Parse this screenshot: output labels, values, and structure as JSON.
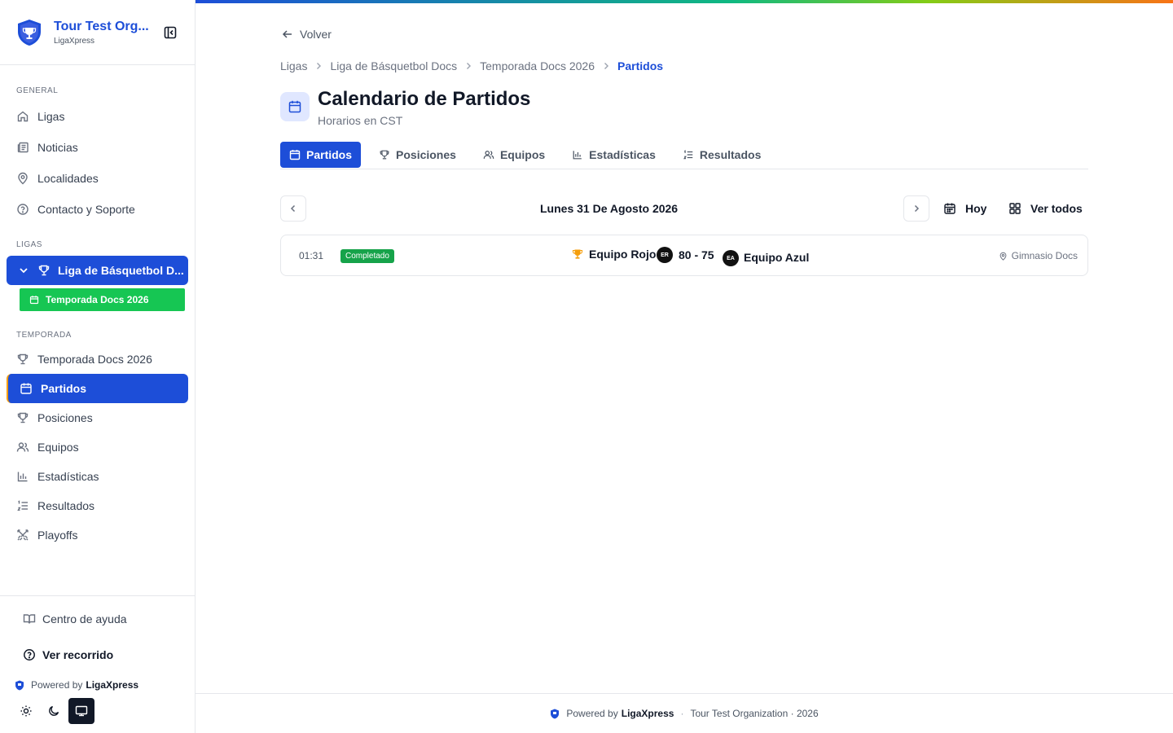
{
  "brand": {
    "name": "Tour Test Org...",
    "sub": "LigaXpress"
  },
  "sidebar": {
    "general_label": "GENERAL",
    "general_items": [
      {
        "label": "Ligas",
        "icon": "home-icon"
      },
      {
        "label": "Noticias",
        "icon": "newspaper-icon"
      },
      {
        "label": "Localidades",
        "icon": "map-pin-icon"
      },
      {
        "label": "Contacto y Soporte",
        "icon": "help-circle-icon"
      }
    ],
    "ligas_label": "LIGAS",
    "active_league": "Liga de Básquetbol D...",
    "active_season": "Temporada Docs 2026",
    "temporada_label": "TEMPORADA",
    "season_items": [
      {
        "label": "Temporada Docs 2026",
        "icon": "trophy-icon"
      },
      {
        "label": "Partidos",
        "icon": "calendar-icon",
        "active": true
      },
      {
        "label": "Posiciones",
        "icon": "trophy-icon"
      },
      {
        "label": "Equipos",
        "icon": "users-icon"
      },
      {
        "label": "Estadísticas",
        "icon": "bar-chart-icon"
      },
      {
        "label": "Resultados",
        "icon": "list-ordered-icon"
      },
      {
        "label": "Playoffs",
        "icon": "swords-icon"
      }
    ],
    "help_center": "Centro de ayuda",
    "tour": "Ver recorrido",
    "powered_prefix": "Powered by",
    "powered_brand": "LigaXpress",
    "theme_active": "system"
  },
  "main": {
    "back_label": "Volver",
    "breadcrumb": [
      "Ligas",
      "Liga de Básquetbol Docs",
      "Temporada Docs 2026"
    ],
    "breadcrumb_current": "Partidos",
    "title": "Calendario de Partidos",
    "subtitle": "Horarios en CST",
    "tabs": [
      {
        "label": "Partidos",
        "icon": "calendar-icon",
        "active": true
      },
      {
        "label": "Posiciones",
        "icon": "trophy-icon"
      },
      {
        "label": "Equipos",
        "icon": "users-icon"
      },
      {
        "label": "Estadísticas",
        "icon": "bar-chart-icon"
      },
      {
        "label": "Resultados",
        "icon": "list-ordered-icon"
      }
    ],
    "date_label": "Lunes 31 De Agosto 2026",
    "today_label": "Hoy",
    "view_all_label": "Ver todos",
    "match": {
      "time": "01:31",
      "status": "Completado",
      "home_team": "Equipo Rojo",
      "home_abbr": "ER",
      "score": "80 - 75",
      "away_abbr": "EA",
      "away_team": "Equipo Azul",
      "venue": "Gimnasio Docs"
    }
  },
  "footer": {
    "powered_prefix": "Powered by",
    "powered_brand": "LigaXpress",
    "org": "Tour Test Organization · 2026"
  },
  "colors": {
    "primary": "#1d4ed8",
    "success": "#16c653",
    "badge": "#16a34a",
    "winner": "#f59e0b"
  }
}
